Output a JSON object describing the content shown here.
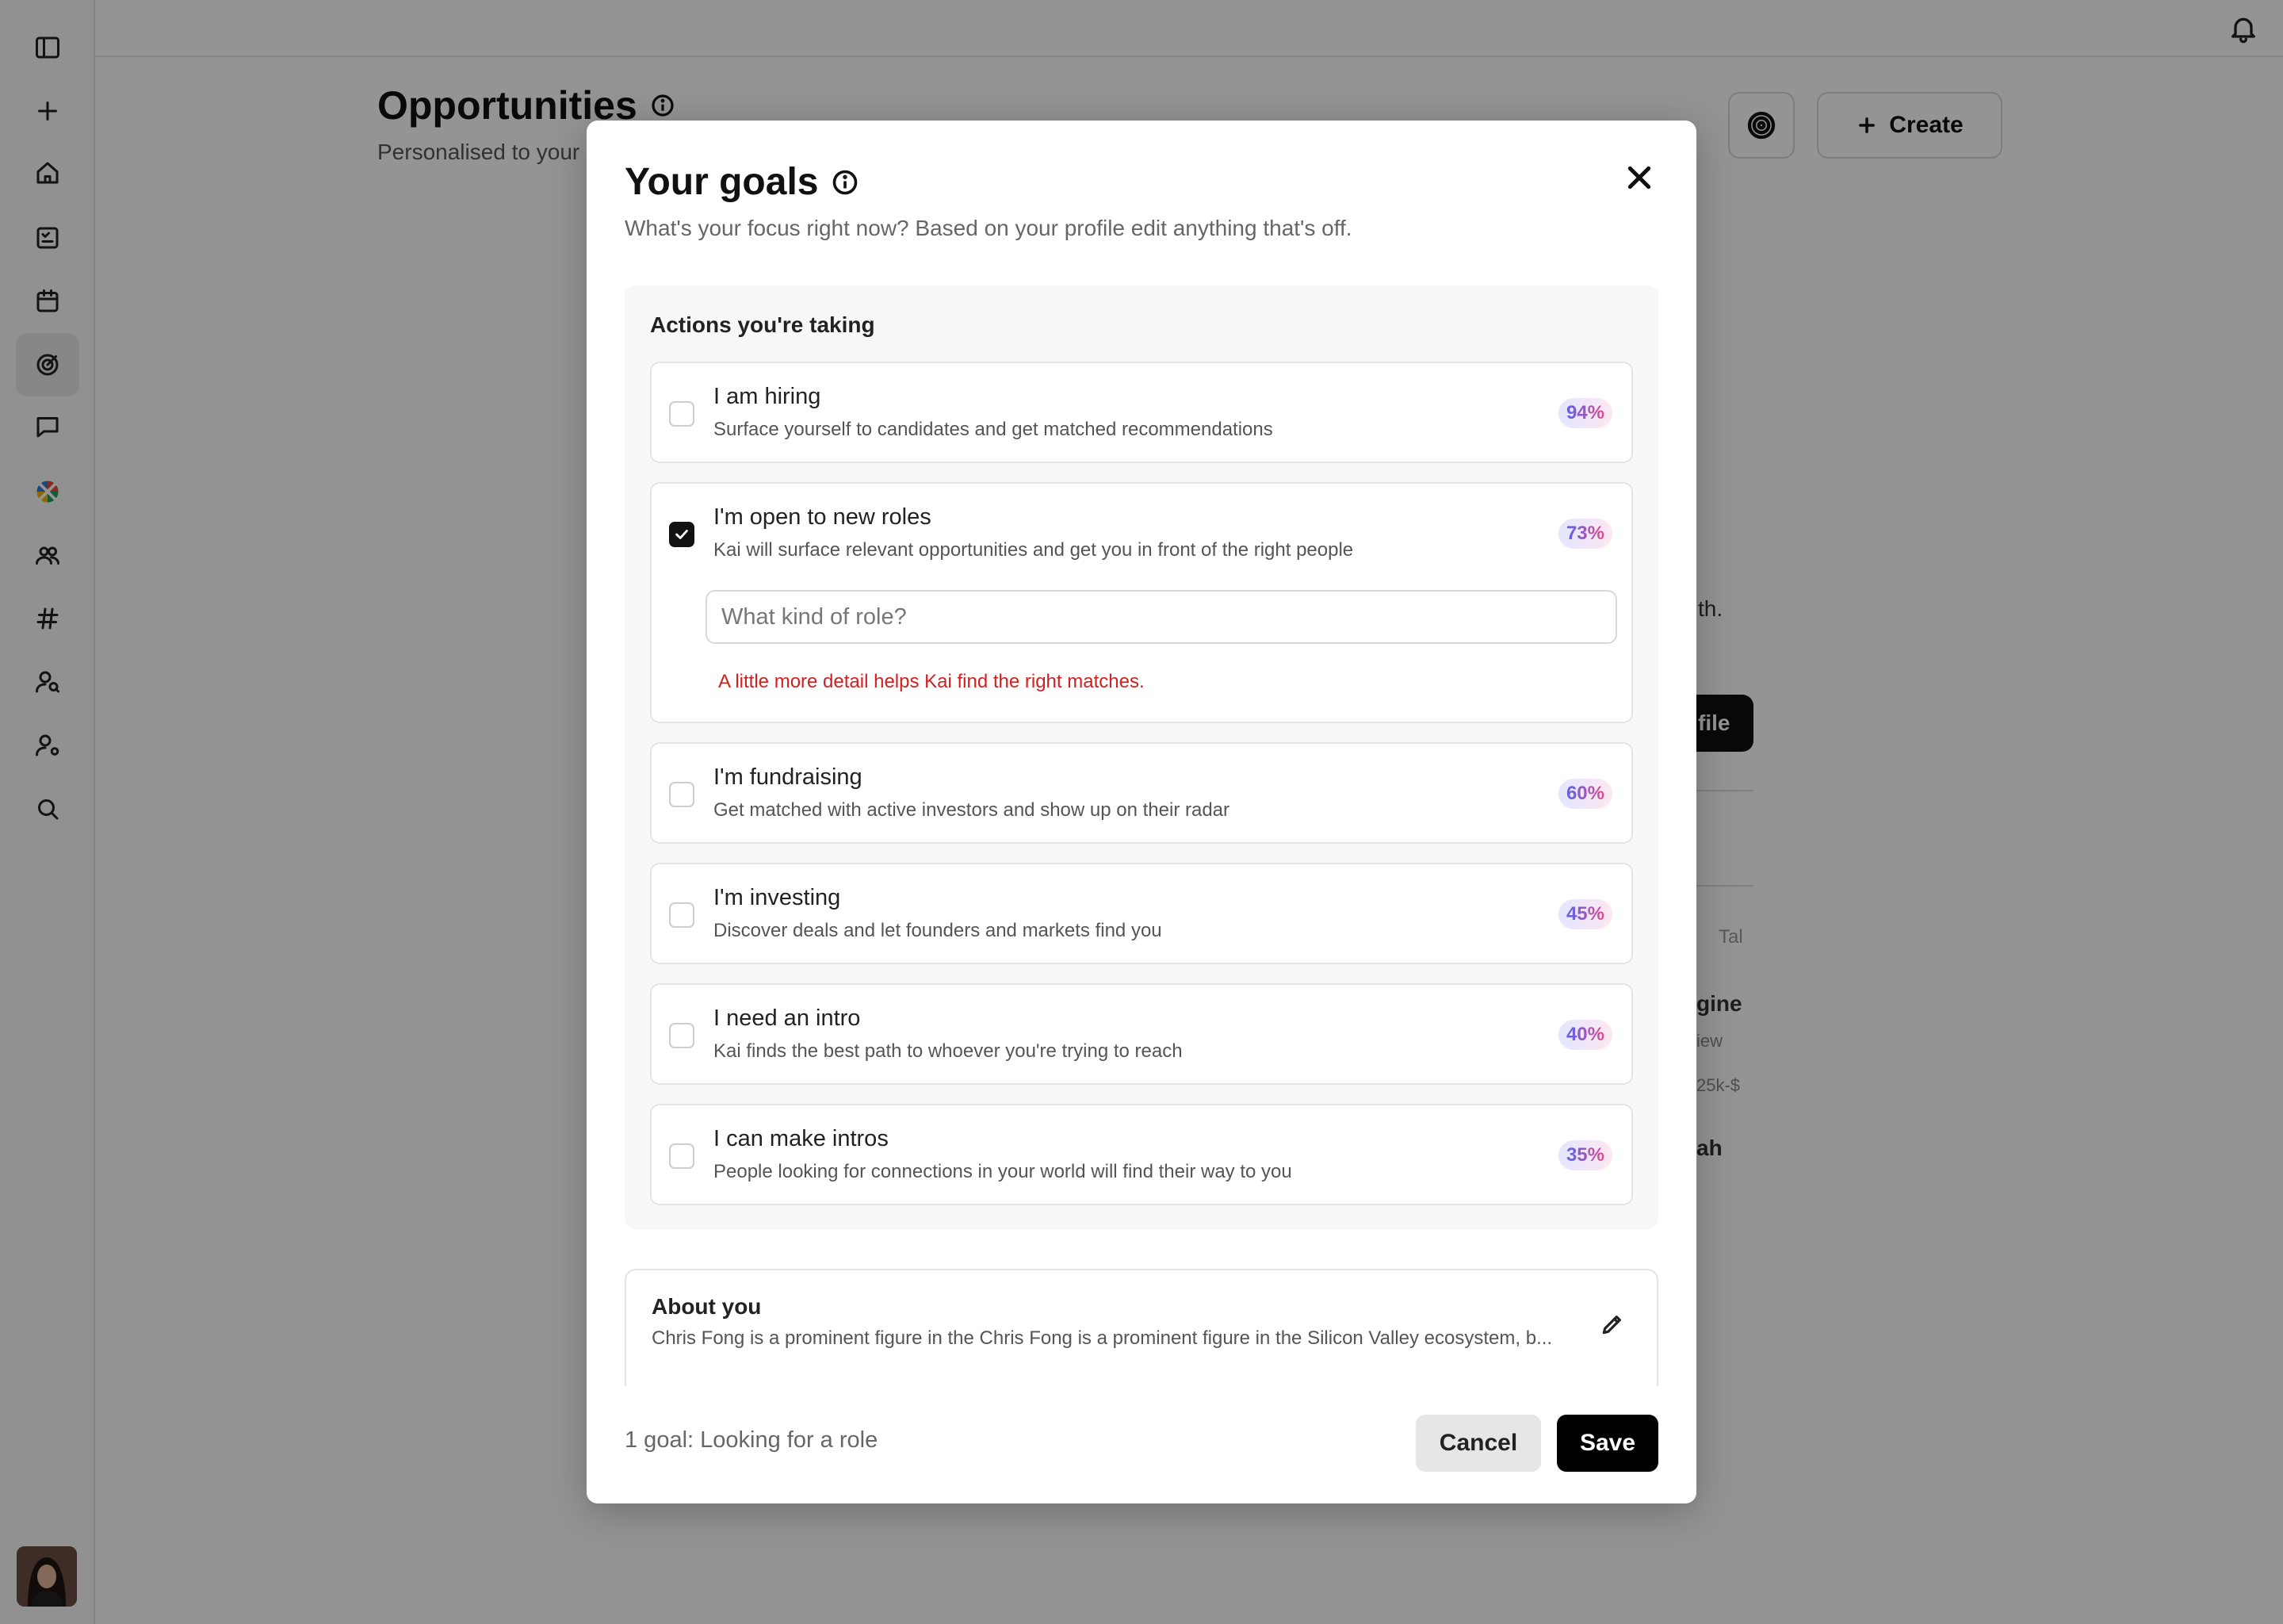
{
  "page": {
    "title": "Opportunities",
    "subtitle": "Personalised to your",
    "create_label": "Create",
    "bg_fragments": {
      "frag1": "th.",
      "frag2": "file",
      "frag3": "Tal",
      "frag4": "gine",
      "frag5": "iew",
      "frag6": "25k-$",
      "frag7": "ah"
    }
  },
  "sidebar": {
    "items": [
      {
        "icon": "sidebar-toggle-icon"
      },
      {
        "icon": "plus-icon"
      },
      {
        "icon": "home-icon"
      },
      {
        "icon": "tasks-icon"
      },
      {
        "icon": "calendar-icon"
      },
      {
        "icon": "goals-icon",
        "active": true
      },
      {
        "icon": "chat-icon"
      },
      {
        "icon": "apps-icon"
      },
      {
        "icon": "people-icon"
      },
      {
        "icon": "hashtag-icon"
      },
      {
        "icon": "contact-search-icon"
      },
      {
        "icon": "user-settings-icon"
      },
      {
        "icon": "search-icon"
      }
    ]
  },
  "modal": {
    "title": "Your goals",
    "subtitle": "What's your focus right now? Based on your profile edit anything that's off.",
    "actions_title": "Actions you're taking",
    "goals": [
      {
        "title": "I am hiring",
        "desc": "Surface yourself to candidates and get matched recommendations",
        "pct": "94%",
        "checked": false
      },
      {
        "title": "I'm open to new roles",
        "desc": "Kai will surface relevant opportunities and get you in front of the right people",
        "pct": "73%",
        "checked": true
      },
      {
        "title": "I'm fundraising",
        "desc": "Get matched with active investors and show up on their radar",
        "pct": "60%",
        "checked": false
      },
      {
        "title": "I'm investing",
        "desc": "Discover deals and let founders and markets find you",
        "pct": "45%",
        "checked": false
      },
      {
        "title": "I need an intro",
        "desc": "Kai finds the best path to whoever you're trying to reach",
        "pct": "40%",
        "checked": false
      },
      {
        "title": "I can make intros",
        "desc": "People looking for connections in your world will find their way to you",
        "pct": "35%",
        "checked": false
      }
    ],
    "role_input": {
      "placeholder": "What kind of role?",
      "value": ""
    },
    "role_hint": "A little more detail helps Kai find the right matches.",
    "about": {
      "title": "About you",
      "text": "Chris Fong is a prominent figure in the Chris Fong is a prominent figure in the Silicon Valley ecosystem, b..."
    },
    "footer_status": "1 goal: Looking for a role",
    "cancel_label": "Cancel",
    "save_label": "Save"
  },
  "colors": {
    "accent": "#000000",
    "error": "#d21f1f",
    "pct_gradient_start": "#5a63f0",
    "pct_gradient_end": "#e24a8b"
  }
}
